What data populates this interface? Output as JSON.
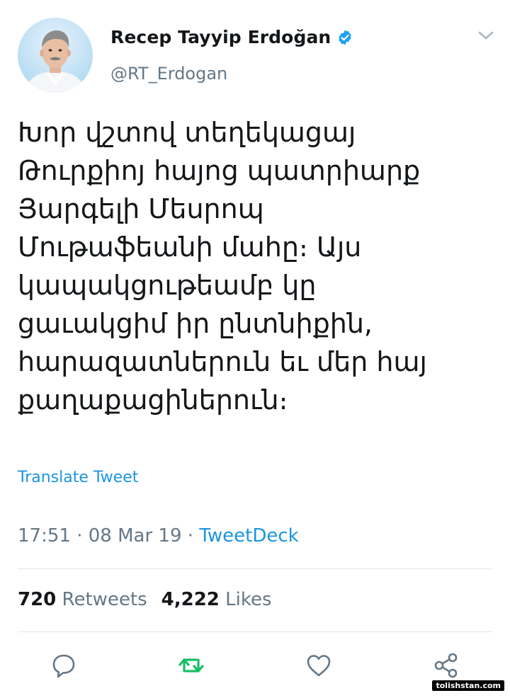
{
  "user": {
    "display_name": "Recep Tayyip Erdoğan",
    "handle": "@RT_Erdogan",
    "verified": true
  },
  "tweet": {
    "text": "Խոր վշտով տեղեկացայ\nԹուրքիոյ հայոց պատրիարք\nՅարգելի Մեսրոպ\nՄութաֆեանի մահը։ Այս\nկապակցութեամբ կը\nցաւակցիմ իր ընտնիքին,\nհարազատներուն եւ մեր հայ\nքաղաքացիներուն։",
    "translate_label": "Translate Tweet",
    "time": "17:51",
    "date": "08 Mar 19",
    "source": "TweetDeck",
    "separator": " · "
  },
  "stats": {
    "retweets_count": "720",
    "retweets_label": "Retweets",
    "likes_count": "4,222",
    "likes_label": "Likes"
  },
  "actions": [
    {
      "name": "reply",
      "icon": "comment-icon"
    },
    {
      "name": "retweet",
      "icon": "retweet-icon",
      "color": "#17bf63"
    },
    {
      "name": "like",
      "icon": "heart-icon"
    },
    {
      "name": "share",
      "icon": "share-icon"
    }
  ],
  "watermark": "tolishstan.com",
  "colors": {
    "link": "#1b95e0",
    "secondary_text": "#657786",
    "retweet_active": "#17bf63",
    "divider": "#e1e8ed"
  }
}
